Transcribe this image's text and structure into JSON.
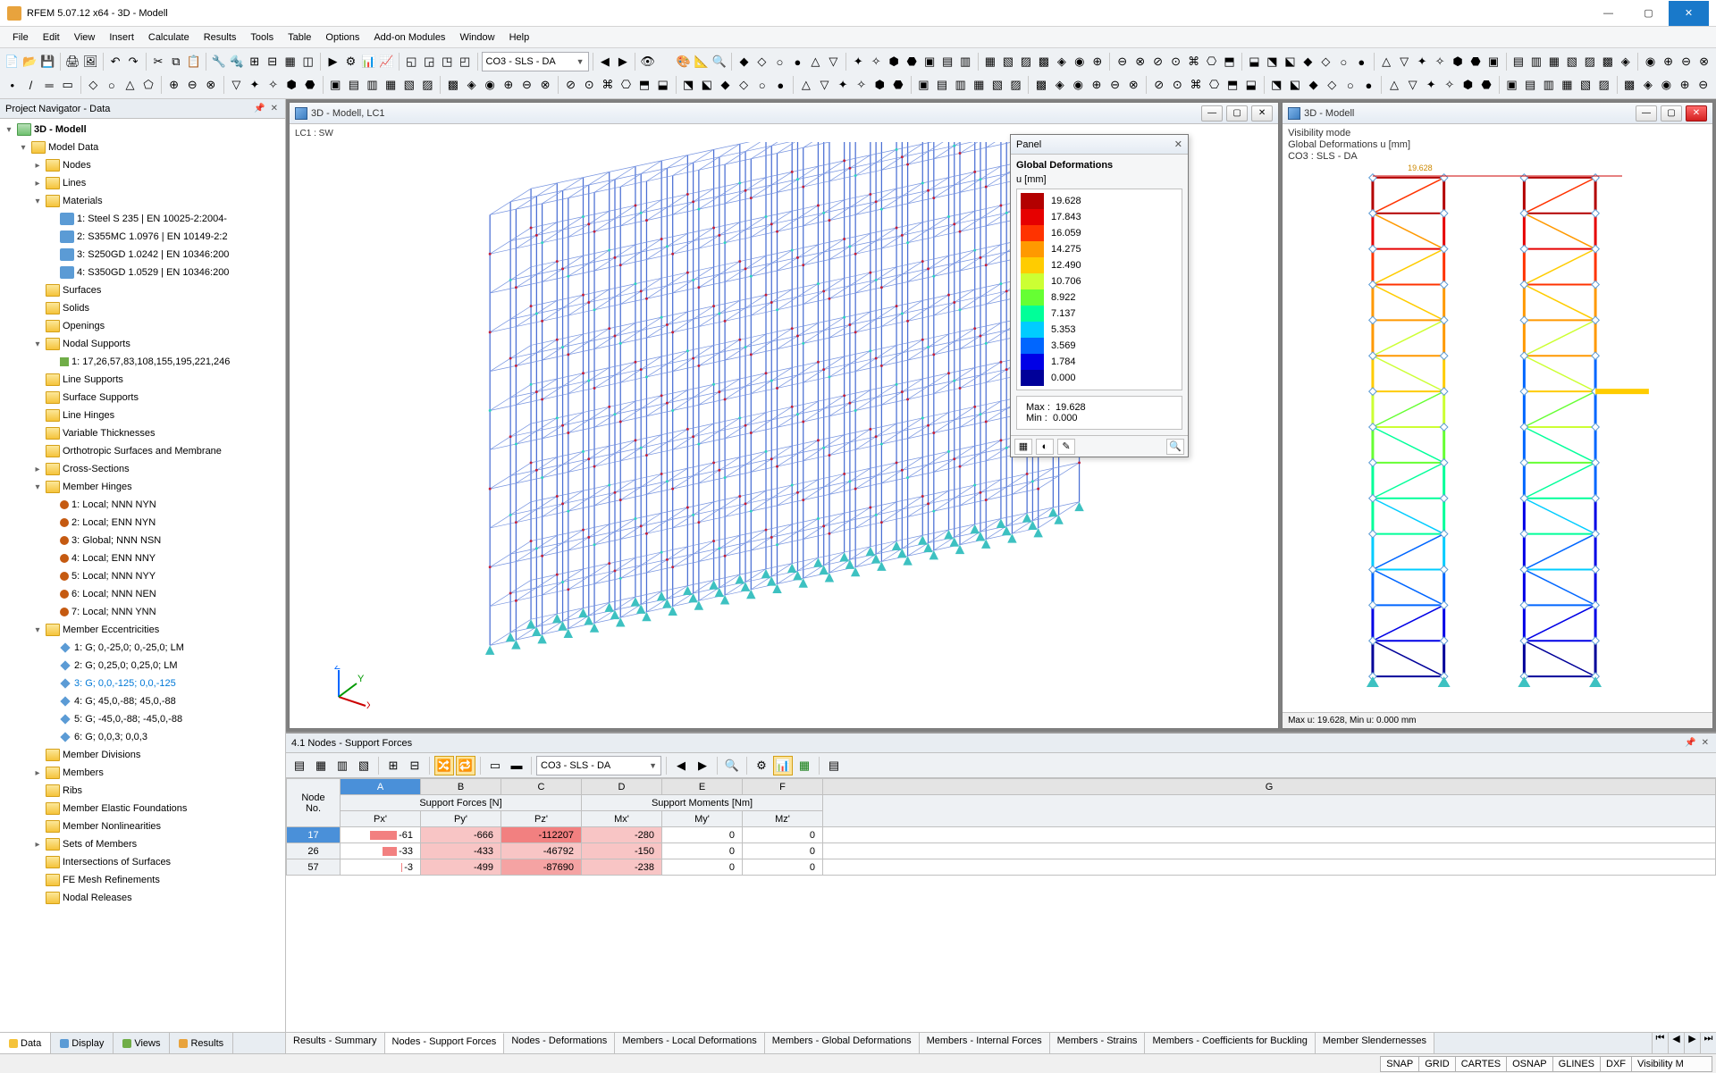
{
  "titlebar": {
    "title": "RFEM 5.07.12 x64 - 3D - Modell"
  },
  "menubar": [
    "File",
    "Edit",
    "View",
    "Insert",
    "Calculate",
    "Results",
    "Tools",
    "Table",
    "Options",
    "Add-on Modules",
    "Window",
    "Help"
  ],
  "toolbar_combo_lc": "CO3 - SLS - DA",
  "navigator": {
    "title": "Project Navigator - Data",
    "root": "3D - Modell",
    "model_data": "Model Data",
    "items": [
      "Nodes",
      "Lines",
      "Materials"
    ],
    "materials": [
      "1: Steel S 235 | EN 10025-2:2004-",
      "2: S355MC 1.0976 | EN 10149-2:2",
      "3: S250GD 1.0242 | EN 10346:200",
      "4: S350GD 1.0529 | EN 10346:200"
    ],
    "after_materials": [
      "Surfaces",
      "Solids",
      "Openings",
      "Nodal Supports"
    ],
    "nodal_support_child": "1: 17,26,57,83,108,155,195,221,246",
    "after_supports": [
      "Line Supports",
      "Surface Supports",
      "Line Hinges",
      "Variable Thicknesses",
      "Orthotropic Surfaces and Membrane",
      "Cross-Sections",
      "Member Hinges"
    ],
    "hinges": [
      "1: Local; NNN NYN",
      "2: Local; ENN NYN",
      "3: Global; NNN NSN",
      "4: Local; ENN NNY",
      "5: Local; NNN NYY",
      "6: Local; NNN NEN",
      "7: Local; NNN YNN"
    ],
    "ecc_label": "Member Eccentricities",
    "eccentricities": [
      "1: G; 0,-25,0; 0,-25,0; LM",
      "2: G; 0,25,0; 0,25,0; LM",
      "3: G; 0,0,-125; 0,0,-125",
      "4: G; 45,0,-88; 45,0,-88",
      "5: G; -45,0,-88; -45,0,-88",
      "6: G; 0,0,3; 0,0,3"
    ],
    "tail": [
      "Member Divisions",
      "Members",
      "Ribs",
      "Member Elastic Foundations",
      "Member Nonlinearities",
      "Sets of Members",
      "Intersections of Surfaces",
      "FE Mesh Refinements",
      "Nodal Releases"
    ],
    "tabs": [
      "Data",
      "Display",
      "Views",
      "Results"
    ]
  },
  "vp_left": {
    "title": "3D - Modell, LC1",
    "info": "LC1 : SW"
  },
  "vp_right": {
    "title": "3D - Modell",
    "info_lines": [
      "Visibility mode",
      "Global Deformations u [mm]",
      "CO3 : SLS - DA"
    ],
    "status": "Max u: 19.628, Min u: 0.000 mm",
    "annotation": "19.628"
  },
  "panel": {
    "title": "Panel",
    "heading": "Global Deformations",
    "unit": "u [mm]",
    "legend": [
      {
        "v": "19.628",
        "c": "#b30000"
      },
      {
        "v": "17.843",
        "c": "#e60000"
      },
      {
        "v": "16.059",
        "c": "#ff3300"
      },
      {
        "v": "14.275",
        "c": "#ff9900"
      },
      {
        "v": "12.490",
        "c": "#ffcc00"
      },
      {
        "v": "10.706",
        "c": "#ccff33"
      },
      {
        "v": "8.922",
        "c": "#66ff33"
      },
      {
        "v": "7.137",
        "c": "#00ff99"
      },
      {
        "v": "5.353",
        "c": "#00ccff"
      },
      {
        "v": "3.569",
        "c": "#0066ff"
      },
      {
        "v": "1.784",
        "c": "#0000e6"
      },
      {
        "v": "0.000",
        "c": "#000099"
      }
    ],
    "max_label": "Max  :",
    "max_val": "19.628",
    "min_label": "Min   :",
    "min_val": "0.000"
  },
  "bottom": {
    "title": "4.1 Nodes - Support Forces",
    "combo": "CO3 - SLS - DA",
    "col_letters": [
      "A",
      "B",
      "C",
      "D",
      "E",
      "F",
      "G"
    ],
    "header_groups": {
      "forces": "Support Forces [N]",
      "moments": "Support Moments [Nm]"
    },
    "header_labels": {
      "node": "Node",
      "no": "No.",
      "px": "Px'",
      "py": "Py'",
      "pz": "Pz'",
      "mx": "Mx'",
      "my": "My'",
      "mz": "Mz'"
    },
    "rows": [
      {
        "no": "17",
        "px": "-61",
        "py": "-666",
        "pz": "-112207",
        "mx": "-280",
        "my": "0",
        "mz": "0"
      },
      {
        "no": "26",
        "px": "-33",
        "py": "-433",
        "pz": "-46792",
        "mx": "-150",
        "my": "0",
        "mz": "0"
      },
      {
        "no": "57",
        "px": "-3",
        "py": "-499",
        "pz": "-87690",
        "mx": "-238",
        "my": "0",
        "mz": "0"
      }
    ],
    "tabs": [
      "Results - Summary",
      "Nodes - Support Forces",
      "Nodes - Deformations",
      "Members - Local Deformations",
      "Members - Global Deformations",
      "Members - Internal Forces",
      "Members - Strains",
      "Members - Coefficients for Buckling",
      "Member Slendernesses"
    ]
  },
  "statusbar": {
    "segs": [
      "SNAP",
      "GRID",
      "CARTES",
      "OSNAP",
      "GLINES",
      "DXF"
    ],
    "input": "Visibility M"
  }
}
